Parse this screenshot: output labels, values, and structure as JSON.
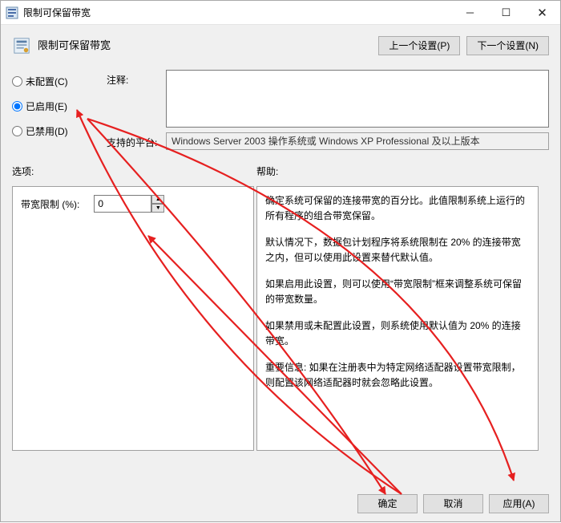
{
  "window": {
    "title": "限制可保留带宽"
  },
  "header": {
    "title": "限制可保留带宽",
    "nav_prev": "上一个设置(P)",
    "nav_next": "下一个设置(N)"
  },
  "radio": {
    "not_configured": "未配置(C)",
    "enabled": "已启用(E)",
    "disabled": "已禁用(D)",
    "selected": "enabled"
  },
  "info": {
    "comment_label": "注释:",
    "comment_value": "",
    "platform_label": "支持的平台:",
    "platform_value": "Windows Server 2003 操作系统或 Windows XP Professional 及以上版本"
  },
  "options": {
    "section_label": "选项:",
    "field_label": "带宽限制 (%):",
    "field_value": "0"
  },
  "help": {
    "section_label": "帮助:",
    "p1": "确定系统可保留的连接带宽的百分比。此值限制系统上运行的所有程序的组合带宽保留。",
    "p2": "默认情况下，数据包计划程序将系统限制在 20% 的连接带宽之内，但可以使用此设置来替代默认值。",
    "p3": "如果启用此设置，则可以使用“带宽限制”框来调整系统可保留的带宽数量。",
    "p4": "如果禁用或未配置此设置，则系统使用默认值为 20% 的连接带宽。",
    "p5": "重要信息: 如果在注册表中为特定网络适配器设置带宽限制，则配置该网络适配器时就会忽略此设置。"
  },
  "footer": {
    "ok": "确定",
    "cancel": "取消",
    "apply": "应用(A)"
  }
}
